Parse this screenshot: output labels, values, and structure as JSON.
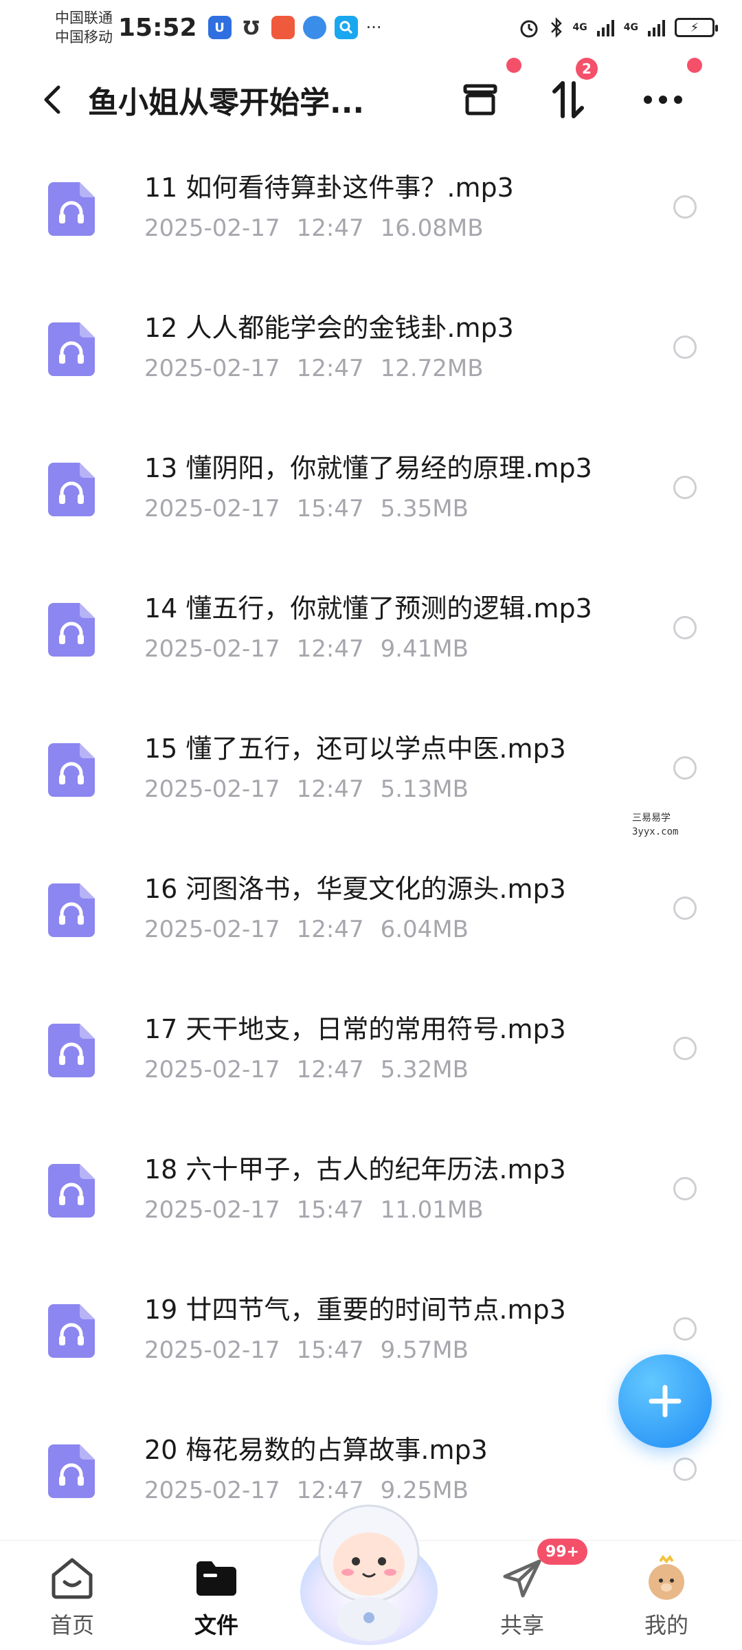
{
  "status_bar": {
    "carrier_1": "中国联通",
    "carrier_2": "中国移动",
    "time": "15:52",
    "notification_icons": [
      "app-notif-icon",
      "app-notif-icon",
      "shop-notif-icon",
      "browser-notif-icon",
      "search-notif-icon"
    ],
    "more": "···",
    "network_1": "4G",
    "network_2": "4G",
    "icons": [
      "alarm-icon",
      "bluetooth-icon",
      "signal-icon",
      "battery-icon"
    ]
  },
  "header": {
    "back_icon": "back-arrow-icon",
    "title": "鱼小姐从零开始学...",
    "actions": [
      {
        "icon": "archive-box-icon",
        "dot": true
      },
      {
        "icon": "sort-icon",
        "badge": "2"
      },
      {
        "icon": "more-icon",
        "dot": true
      }
    ]
  },
  "files": [
    {
      "name": "11 如何看待算卦这件事？.mp3",
      "date": "2025-02-17",
      "time": "12:47",
      "size": "16.08MB"
    },
    {
      "name": "12 人人都能学会的金钱卦.mp3",
      "date": "2025-02-17",
      "time": "12:47",
      "size": "12.72MB"
    },
    {
      "name": "13 懂阴阳，你就懂了易经的原理.mp3",
      "date": "2025-02-17",
      "time": "15:47",
      "size": "5.35MB"
    },
    {
      "name": "14 懂五行，你就懂了预测的逻辑.mp3",
      "date": "2025-02-17",
      "time": "12:47",
      "size": "9.41MB"
    },
    {
      "name": "15 懂了五行，还可以学点中医.mp3",
      "date": "2025-02-17",
      "time": "12:47",
      "size": "5.13MB"
    },
    {
      "name": "16 河图洛书，华夏文化的源头.mp3",
      "date": "2025-02-17",
      "time": "12:47",
      "size": "6.04MB"
    },
    {
      "name": "17 天干地支，日常的常用符号.mp3",
      "date": "2025-02-17",
      "time": "12:47",
      "size": "5.32MB"
    },
    {
      "name": "18 六十甲子，古人的纪年历法.mp3",
      "date": "2025-02-17",
      "time": "15:47",
      "size": "11.01MB"
    },
    {
      "name": "19 廿四节气，重要的时间节点.mp3",
      "date": "2025-02-17",
      "time": "15:47",
      "size": "9.57MB"
    },
    {
      "name": "20 梅花易数的占算故事.mp3",
      "date": "2025-02-17",
      "time": "12:47",
      "size": "9.25MB"
    }
  ],
  "file_icon": "audio-file-icon",
  "watermark": {
    "line1": "三易易学",
    "line2": "3yyx.com"
  },
  "fab": {
    "icon": "plus-icon"
  },
  "bottom_nav": {
    "items": [
      {
        "label": "首页",
        "icon": "home-icon",
        "active": false
      },
      {
        "label": "文件",
        "icon": "folder-icon",
        "active": true
      },
      {
        "label": "共享",
        "icon": "paper-plane-icon",
        "active": false,
        "badge": "99+"
      },
      {
        "label": "我的",
        "icon": "profile-avatar-icon",
        "active": false
      }
    ],
    "center_icon": "mascot-icon"
  },
  "colors": {
    "accent": "#1e8bf5",
    "file_icon": "#8c86f0",
    "badge": "#f4506a",
    "meta_text": "#a6a6ad"
  }
}
